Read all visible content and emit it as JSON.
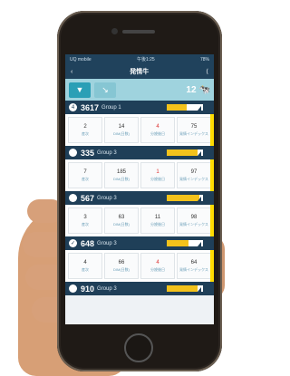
{
  "status_bar": {
    "carrier": "UQ mobile",
    "time": "午後1:25",
    "battery": "78%"
  },
  "nav": {
    "back_icon": "chevron-left-icon",
    "title": "発情牛",
    "share_icon": "share-icon"
  },
  "toolbar": {
    "count": "12"
  },
  "cards": [
    {
      "id": "3617",
      "group": "Group 1",
      "icon": "circle-number-icon",
      "stats": [
        {
          "v": "2",
          "label": "産次",
          "red": false
        },
        {
          "v": "14",
          "label": "DIM(日数)",
          "red": false
        },
        {
          "v": "4",
          "label": "分娩後日",
          "red": true
        },
        {
          "v": "75",
          "label": "発情インデックス",
          "red": false
        }
      ],
      "bar_level": 0.55
    },
    {
      "id": "335",
      "group": "Group 3",
      "icon": "circle-icon",
      "stats": [
        {
          "v": "7",
          "label": "産次",
          "red": false
        },
        {
          "v": "185",
          "label": "DIM(日数)",
          "red": false
        },
        {
          "v": "1",
          "label": "分娩後日",
          "red": true
        },
        {
          "v": "97",
          "label": "発情インデックス",
          "red": false
        }
      ],
      "bar_level": 0.85
    },
    {
      "id": "567",
      "group": "Group 3",
      "icon": "circle-icon",
      "stats": [
        {
          "v": "3",
          "label": "産次",
          "red": false
        },
        {
          "v": "63",
          "label": "DIM(日数)",
          "red": false
        },
        {
          "v": "11",
          "label": "分娩後日",
          "red": false
        },
        {
          "v": "98",
          "label": "発情インデックス",
          "red": false
        }
      ],
      "bar_level": 0.9
    },
    {
      "id": "648",
      "group": "Group 3",
      "icon": "check-circle-icon",
      "stats": [
        {
          "v": "4",
          "label": "産次",
          "red": false
        },
        {
          "v": "66",
          "label": "DIM(日数)",
          "red": false
        },
        {
          "v": "4",
          "label": "分娩後日",
          "red": true
        },
        {
          "v": "64",
          "label": "発情インデックス",
          "red": false
        }
      ],
      "bar_level": 0.6
    },
    {
      "id": "910",
      "group": "Group 3",
      "icon": "circle-icon",
      "stats": [],
      "bar_level": 0.85
    }
  ]
}
